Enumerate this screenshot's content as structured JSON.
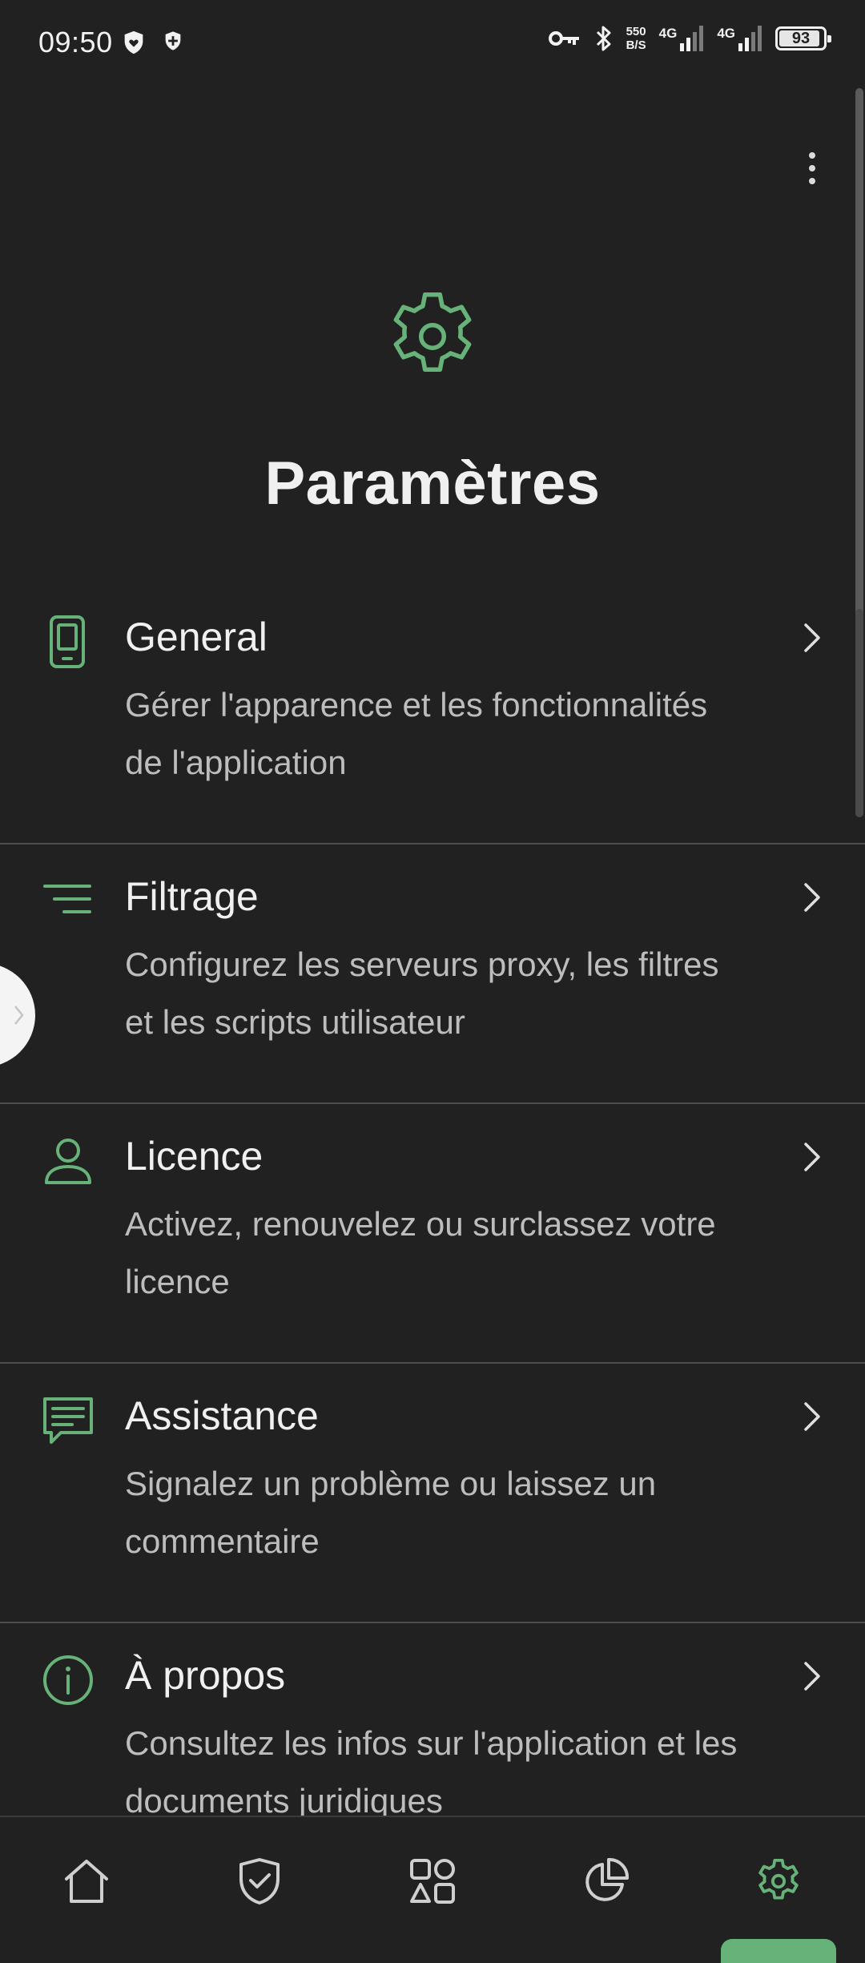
{
  "status_bar": {
    "time": "09:50",
    "net_speed_value": "550",
    "net_speed_unit": "B/S",
    "signal1_label": "4G",
    "signal2_label": "4G",
    "battery": "93",
    "battery_level": 0.93
  },
  "header": {
    "title": "Paramètres",
    "icon": "gear-icon"
  },
  "settings": [
    {
      "icon": "phone-icon",
      "title": "General",
      "description": "Gérer l'apparence et les fonctionnalités de l'application"
    },
    {
      "icon": "filter-icon",
      "title": "Filtrage",
      "description": "Configurez les serveurs proxy, les filtres et les scripts utilisateur"
    },
    {
      "icon": "user-icon",
      "title": "Licence",
      "description": "Activez, renouvelez ou surclassez votre licence"
    },
    {
      "icon": "chat-icon",
      "title": "Assistance",
      "description": "Signalez un problème ou laissez un commentaire"
    },
    {
      "icon": "info-icon",
      "title": "À propos",
      "description": "Consultez les infos sur l'application et les documents juridiques"
    }
  ],
  "bottom_nav": {
    "items": [
      "home-icon",
      "shield-check-icon",
      "apps-icon",
      "stats-pie-icon",
      "settings-gear-icon"
    ],
    "active_index": 4
  },
  "colors": {
    "accent": "#67b279",
    "background": "#212121",
    "text_primary": "#f0f0f0",
    "text_secondary": "#bdbdbd",
    "divider": "#4e4e4e"
  }
}
